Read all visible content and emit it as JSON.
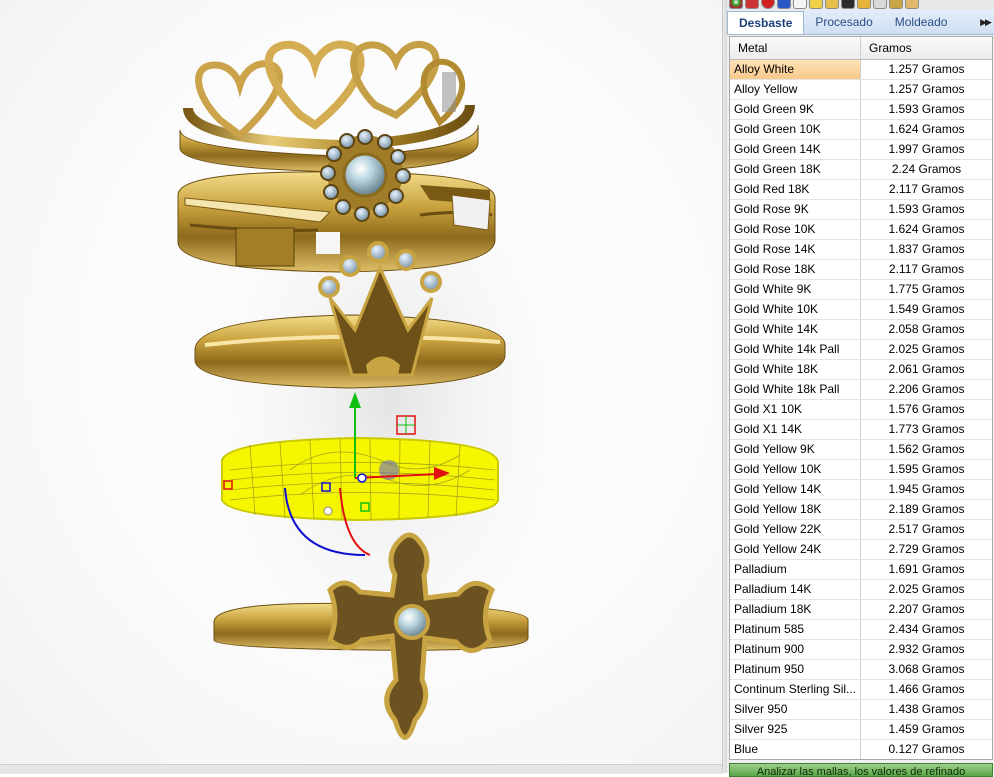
{
  "tabs": [
    {
      "label": "Desbaste",
      "active": true
    },
    {
      "label": "Procesado",
      "active": false
    },
    {
      "label": "Moldeado",
      "active": false
    }
  ],
  "tabs_overflow_icon": "double-chevron-right-icon",
  "table": {
    "headers": {
      "metal": "Metal",
      "grams": "Gramos"
    },
    "selected_index": 0,
    "rows": [
      {
        "metal": "Alloy White",
        "grams": "1.257 Gramos"
      },
      {
        "metal": "Alloy Yellow",
        "grams": "1.257 Gramos"
      },
      {
        "metal": "Gold Green 9K",
        "grams": "1.593 Gramos"
      },
      {
        "metal": "Gold Green 10K",
        "grams": "1.624 Gramos"
      },
      {
        "metal": "Gold Green 14K",
        "grams": "1.997 Gramos"
      },
      {
        "metal": "Gold Green 18K",
        "grams": "2.24 Gramos"
      },
      {
        "metal": "Gold Red 18K",
        "grams": "2.117 Gramos"
      },
      {
        "metal": "Gold Rose 9K",
        "grams": "1.593 Gramos"
      },
      {
        "metal": "Gold Rose 10K",
        "grams": "1.624 Gramos"
      },
      {
        "metal": "Gold Rose 14K",
        "grams": "1.837 Gramos"
      },
      {
        "metal": "Gold Rose 18K",
        "grams": "2.117 Gramos"
      },
      {
        "metal": "Gold White 9K",
        "grams": "1.775 Gramos"
      },
      {
        "metal": "Gold White 10K",
        "grams": "1.549 Gramos"
      },
      {
        "metal": "Gold White 14K",
        "grams": "2.058 Gramos"
      },
      {
        "metal": "Gold White 14k Pall",
        "grams": "2.025 Gramos"
      },
      {
        "metal": "Gold White 18K",
        "grams": "2.061 Gramos"
      },
      {
        "metal": "Gold White 18k Pall",
        "grams": "2.206 Gramos"
      },
      {
        "metal": "Gold X1 10K",
        "grams": "1.576 Gramos"
      },
      {
        "metal": "Gold X1 14K",
        "grams": "1.773 Gramos"
      },
      {
        "metal": "Gold Yellow 9K",
        "grams": "1.562 Gramos"
      },
      {
        "metal": "Gold Yellow 10K",
        "grams": "1.595 Gramos"
      },
      {
        "metal": "Gold Yellow 14K",
        "grams": "1.945 Gramos"
      },
      {
        "metal": "Gold Yellow 18K",
        "grams": "2.189 Gramos"
      },
      {
        "metal": "Gold Yellow 22K",
        "grams": "2.517 Gramos"
      },
      {
        "metal": "Gold Yellow 24K",
        "grams": "2.729 Gramos"
      },
      {
        "metal": "Palladium",
        "grams": "1.691 Gramos"
      },
      {
        "metal": "Palladium 14K",
        "grams": "2.025 Gramos"
      },
      {
        "metal": "Palladium 18K",
        "grams": "2.207 Gramos"
      },
      {
        "metal": "Platinum 585",
        "grams": "2.434 Gramos"
      },
      {
        "metal": "Platinum 900",
        "grams": "2.932 Gramos"
      },
      {
        "metal": "Platinum 950",
        "grams": "3.068 Gramos"
      },
      {
        "metal": "Continum Sterling Sil...",
        "grams": "1.466 Gramos"
      },
      {
        "metal": "Silver 950",
        "grams": "1.438 Gramos"
      },
      {
        "metal": "Silver 925",
        "grams": "1.459 Gramos"
      },
      {
        "metal": "Blue",
        "grams": "0.127 Gramos"
      }
    ]
  },
  "bottom_button": {
    "label": "Analizar las mallas, los valores de refinado"
  },
  "toolbar_icons": [
    "sphere-icon",
    "shield-icon",
    "globe-icon",
    "cube-icon",
    "pencil-icon",
    "folder-icon",
    "layers-icon",
    "grid-icon",
    "gem-icon",
    "ring-icon",
    "cup-icon",
    "hand-icon"
  ],
  "colors": {
    "gold": "#b8922e",
    "selection": "#f9c98b",
    "tab_text": "#2a4e86",
    "wireframe": "#f2f200",
    "axis_x": "#e01010",
    "axis_y": "#10c010",
    "axis_z": "#1010d0"
  }
}
